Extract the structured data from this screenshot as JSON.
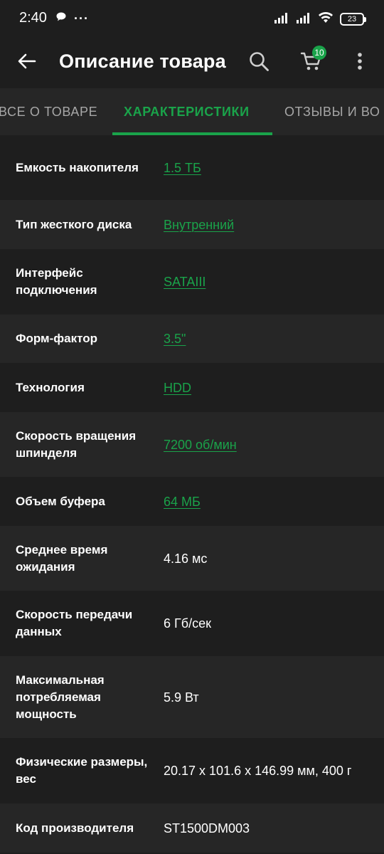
{
  "status_bar": {
    "time": "2:40",
    "more_indicator": "···",
    "battery_level": "23"
  },
  "header": {
    "title": "Описание товара",
    "cart_count": "10"
  },
  "tabs": [
    {
      "label": "ВСЕ О ТОВАРЕ",
      "active": false
    },
    {
      "label": "ХАРАКТЕРИСТИКИ",
      "active": true
    },
    {
      "label": "ОТЗЫВЫ И ВО",
      "active": false
    }
  ],
  "specs": [
    {
      "label": "Емкость накопителя",
      "value": "1.5 ТБ",
      "link": true
    },
    {
      "label": "Тип жесткого диска",
      "value": "Внутренний",
      "link": true
    },
    {
      "label": "Интерфейс подключения",
      "value": "SATAIII",
      "link": true
    },
    {
      "label": "Форм-фактор",
      "value": "3.5\"",
      "link": true
    },
    {
      "label": "Технология",
      "value": "HDD",
      "link": true
    },
    {
      "label": "Скорость вращения шпинделя",
      "value": "7200 об/мин",
      "link": true
    },
    {
      "label": "Объем буфера",
      "value": "64 МБ",
      "link": true
    },
    {
      "label": "Среднее время ожидания",
      "value": "4.16 мс",
      "link": false
    },
    {
      "label": "Скорость передачи данных",
      "value": "6 Гб/сек",
      "link": false
    },
    {
      "label": "Максимальная потребляемая мощность",
      "value": "5.9 Вт",
      "link": false
    },
    {
      "label": "Физические размеры, вес",
      "value": "20.17 x 101.6 x 146.99 мм, 400 г",
      "link": false
    },
    {
      "label": "Код производителя",
      "value": "ST1500DM003",
      "link": false
    }
  ],
  "colors": {
    "accent": "#1aa34a",
    "background": "#1e1e1e",
    "row_alt": "#262626",
    "tab_inactive": "#a7a7a7"
  }
}
